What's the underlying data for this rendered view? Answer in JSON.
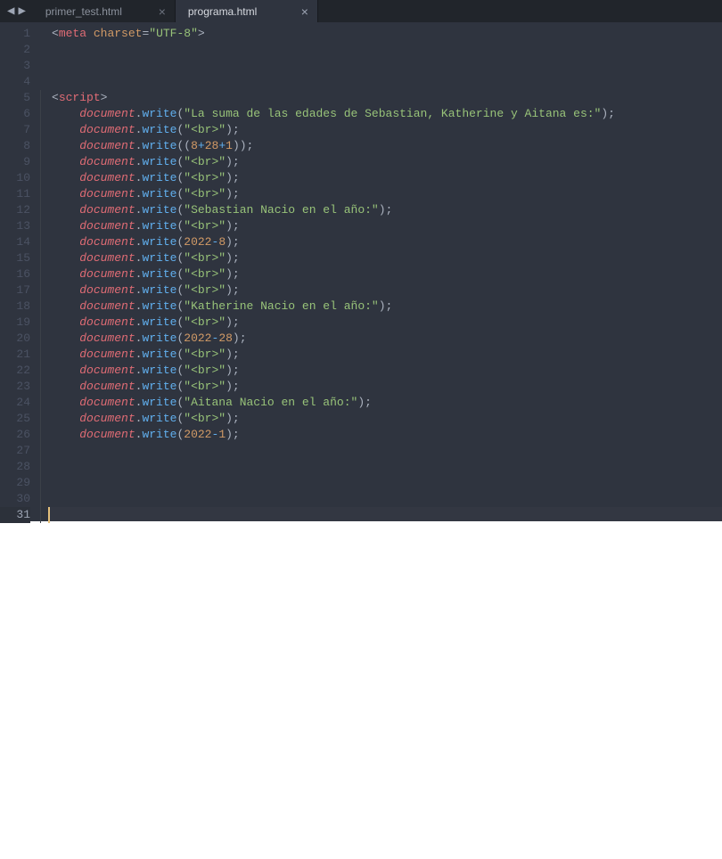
{
  "tabs": [
    {
      "name": "primer_test.html",
      "active": false
    },
    {
      "name": "programa.html",
      "active": true
    }
  ],
  "lineCount": 31,
  "activeLine": 31,
  "foldStart": 5,
  "code": [
    [
      {
        "c": "c-punct",
        "t": "<"
      },
      {
        "c": "c-red",
        "t": "meta"
      },
      {
        "c": "c-punct",
        "t": " "
      },
      {
        "c": "c-orange",
        "t": "charset"
      },
      {
        "c": "c-punct",
        "t": "="
      },
      {
        "c": "c-green",
        "t": "\"UTF-8\""
      },
      {
        "c": "c-punct",
        "t": ">"
      }
    ],
    [],
    [],
    [],
    [
      {
        "c": "c-punct",
        "t": "<"
      },
      {
        "c": "c-red",
        "t": "script"
      },
      {
        "c": "c-punct",
        "t": ">"
      }
    ],
    [
      {
        "c": "c-punct",
        "t": "    "
      },
      {
        "c": "c-red c-ital",
        "t": "document"
      },
      {
        "c": "c-punct",
        "t": "."
      },
      {
        "c": "c-blue",
        "t": "write"
      },
      {
        "c": "c-punct",
        "t": "("
      },
      {
        "c": "c-green",
        "t": "\"La suma de las edades de Sebastian, Katherine y Aitana es:\""
      },
      {
        "c": "c-punct",
        "t": ");"
      }
    ],
    [
      {
        "c": "c-punct",
        "t": "    "
      },
      {
        "c": "c-red c-ital",
        "t": "document"
      },
      {
        "c": "c-punct",
        "t": "."
      },
      {
        "c": "c-blue",
        "t": "write"
      },
      {
        "c": "c-punct",
        "t": "("
      },
      {
        "c": "c-green",
        "t": "\"<br>\""
      },
      {
        "c": "c-punct",
        "t": ");"
      }
    ],
    [
      {
        "c": "c-punct",
        "t": "    "
      },
      {
        "c": "c-red c-ital",
        "t": "document"
      },
      {
        "c": "c-punct",
        "t": "."
      },
      {
        "c": "c-blue",
        "t": "write"
      },
      {
        "c": "c-punct",
        "t": "(("
      },
      {
        "c": "c-orange",
        "t": "8"
      },
      {
        "c": "c-blue",
        "t": "+"
      },
      {
        "c": "c-orange",
        "t": "28"
      },
      {
        "c": "c-blue",
        "t": "+"
      },
      {
        "c": "c-orange",
        "t": "1"
      },
      {
        "c": "c-punct",
        "t": "));"
      }
    ],
    [
      {
        "c": "c-punct",
        "t": "    "
      },
      {
        "c": "c-red c-ital",
        "t": "document"
      },
      {
        "c": "c-punct",
        "t": "."
      },
      {
        "c": "c-blue",
        "t": "write"
      },
      {
        "c": "c-punct",
        "t": "("
      },
      {
        "c": "c-green",
        "t": "\"<br>\""
      },
      {
        "c": "c-punct",
        "t": ");"
      }
    ],
    [
      {
        "c": "c-punct",
        "t": "    "
      },
      {
        "c": "c-red c-ital",
        "t": "document"
      },
      {
        "c": "c-punct",
        "t": "."
      },
      {
        "c": "c-blue",
        "t": "write"
      },
      {
        "c": "c-punct",
        "t": "("
      },
      {
        "c": "c-green",
        "t": "\"<br>\""
      },
      {
        "c": "c-punct",
        "t": ");"
      }
    ],
    [
      {
        "c": "c-punct",
        "t": "    "
      },
      {
        "c": "c-red c-ital",
        "t": "document"
      },
      {
        "c": "c-punct",
        "t": "."
      },
      {
        "c": "c-blue",
        "t": "write"
      },
      {
        "c": "c-punct",
        "t": "("
      },
      {
        "c": "c-green",
        "t": "\"<br>\""
      },
      {
        "c": "c-punct",
        "t": ");"
      }
    ],
    [
      {
        "c": "c-punct",
        "t": "    "
      },
      {
        "c": "c-red c-ital",
        "t": "document"
      },
      {
        "c": "c-punct",
        "t": "."
      },
      {
        "c": "c-blue",
        "t": "write"
      },
      {
        "c": "c-punct",
        "t": "("
      },
      {
        "c": "c-green",
        "t": "\"Sebastian Nacio en el año:\""
      },
      {
        "c": "c-punct",
        "t": ");"
      }
    ],
    [
      {
        "c": "c-punct",
        "t": "    "
      },
      {
        "c": "c-red c-ital",
        "t": "document"
      },
      {
        "c": "c-punct",
        "t": "."
      },
      {
        "c": "c-blue",
        "t": "write"
      },
      {
        "c": "c-punct",
        "t": "("
      },
      {
        "c": "c-green",
        "t": "\"<br>\""
      },
      {
        "c": "c-punct",
        "t": ");"
      }
    ],
    [
      {
        "c": "c-punct",
        "t": "    "
      },
      {
        "c": "c-red c-ital",
        "t": "document"
      },
      {
        "c": "c-punct",
        "t": "."
      },
      {
        "c": "c-blue",
        "t": "write"
      },
      {
        "c": "c-punct",
        "t": "("
      },
      {
        "c": "c-orange",
        "t": "2022"
      },
      {
        "c": "c-blue",
        "t": "-"
      },
      {
        "c": "c-orange",
        "t": "8"
      },
      {
        "c": "c-punct",
        "t": ");"
      }
    ],
    [
      {
        "c": "c-punct",
        "t": "    "
      },
      {
        "c": "c-red c-ital",
        "t": "document"
      },
      {
        "c": "c-punct",
        "t": "."
      },
      {
        "c": "c-blue",
        "t": "write"
      },
      {
        "c": "c-punct",
        "t": "("
      },
      {
        "c": "c-green",
        "t": "\"<br>\""
      },
      {
        "c": "c-punct",
        "t": ");"
      }
    ],
    [
      {
        "c": "c-punct",
        "t": "    "
      },
      {
        "c": "c-red c-ital",
        "t": "document"
      },
      {
        "c": "c-punct",
        "t": "."
      },
      {
        "c": "c-blue",
        "t": "write"
      },
      {
        "c": "c-punct",
        "t": "("
      },
      {
        "c": "c-green",
        "t": "\"<br>\""
      },
      {
        "c": "c-punct",
        "t": ");"
      }
    ],
    [
      {
        "c": "c-punct",
        "t": "    "
      },
      {
        "c": "c-red c-ital",
        "t": "document"
      },
      {
        "c": "c-punct",
        "t": "."
      },
      {
        "c": "c-blue",
        "t": "write"
      },
      {
        "c": "c-punct",
        "t": "("
      },
      {
        "c": "c-green",
        "t": "\"<br>\""
      },
      {
        "c": "c-punct",
        "t": ");"
      }
    ],
    [
      {
        "c": "c-punct",
        "t": "    "
      },
      {
        "c": "c-red c-ital",
        "t": "document"
      },
      {
        "c": "c-punct",
        "t": "."
      },
      {
        "c": "c-blue",
        "t": "write"
      },
      {
        "c": "c-punct",
        "t": "("
      },
      {
        "c": "c-green",
        "t": "\"Katherine Nacio en el año:\""
      },
      {
        "c": "c-punct",
        "t": ");"
      }
    ],
    [
      {
        "c": "c-punct",
        "t": "    "
      },
      {
        "c": "c-red c-ital",
        "t": "document"
      },
      {
        "c": "c-punct",
        "t": "."
      },
      {
        "c": "c-blue",
        "t": "write"
      },
      {
        "c": "c-punct",
        "t": "("
      },
      {
        "c": "c-green",
        "t": "\"<br>\""
      },
      {
        "c": "c-punct",
        "t": ");"
      }
    ],
    [
      {
        "c": "c-punct",
        "t": "    "
      },
      {
        "c": "c-red c-ital",
        "t": "document"
      },
      {
        "c": "c-punct",
        "t": "."
      },
      {
        "c": "c-blue",
        "t": "write"
      },
      {
        "c": "c-punct",
        "t": "("
      },
      {
        "c": "c-orange",
        "t": "2022"
      },
      {
        "c": "c-blue",
        "t": "-"
      },
      {
        "c": "c-orange",
        "t": "28"
      },
      {
        "c": "c-punct",
        "t": ");"
      }
    ],
    [
      {
        "c": "c-punct",
        "t": "    "
      },
      {
        "c": "c-red c-ital",
        "t": "document"
      },
      {
        "c": "c-punct",
        "t": "."
      },
      {
        "c": "c-blue",
        "t": "write"
      },
      {
        "c": "c-punct",
        "t": "("
      },
      {
        "c": "c-green",
        "t": "\"<br>\""
      },
      {
        "c": "c-punct",
        "t": ");"
      }
    ],
    [
      {
        "c": "c-punct",
        "t": "    "
      },
      {
        "c": "c-red c-ital",
        "t": "document"
      },
      {
        "c": "c-punct",
        "t": "."
      },
      {
        "c": "c-blue",
        "t": "write"
      },
      {
        "c": "c-punct",
        "t": "("
      },
      {
        "c": "c-green",
        "t": "\"<br>\""
      },
      {
        "c": "c-punct",
        "t": ");"
      }
    ],
    [
      {
        "c": "c-punct",
        "t": "    "
      },
      {
        "c": "c-red c-ital",
        "t": "document"
      },
      {
        "c": "c-punct",
        "t": "."
      },
      {
        "c": "c-blue",
        "t": "write"
      },
      {
        "c": "c-punct",
        "t": "("
      },
      {
        "c": "c-green",
        "t": "\"<br>\""
      },
      {
        "c": "c-punct",
        "t": ");"
      }
    ],
    [
      {
        "c": "c-punct",
        "t": "    "
      },
      {
        "c": "c-red c-ital",
        "t": "document"
      },
      {
        "c": "c-punct",
        "t": "."
      },
      {
        "c": "c-blue",
        "t": "write"
      },
      {
        "c": "c-punct",
        "t": "("
      },
      {
        "c": "c-green",
        "t": "\"Aitana Nacio en el año:\""
      },
      {
        "c": "c-punct",
        "t": ");"
      }
    ],
    [
      {
        "c": "c-punct",
        "t": "    "
      },
      {
        "c": "c-red c-ital",
        "t": "document"
      },
      {
        "c": "c-punct",
        "t": "."
      },
      {
        "c": "c-blue",
        "t": "write"
      },
      {
        "c": "c-punct",
        "t": "("
      },
      {
        "c": "c-green",
        "t": "\"<br>\""
      },
      {
        "c": "c-punct",
        "t": ");"
      }
    ],
    [
      {
        "c": "c-punct",
        "t": "    "
      },
      {
        "c": "c-red c-ital",
        "t": "document"
      },
      {
        "c": "c-punct",
        "t": "."
      },
      {
        "c": "c-blue",
        "t": "write"
      },
      {
        "c": "c-punct",
        "t": "("
      },
      {
        "c": "c-orange",
        "t": "2022"
      },
      {
        "c": "c-blue",
        "t": "-"
      },
      {
        "c": "c-orange",
        "t": "1"
      },
      {
        "c": "c-punct",
        "t": ");"
      }
    ],
    [],
    [],
    [],
    [],
    []
  ]
}
